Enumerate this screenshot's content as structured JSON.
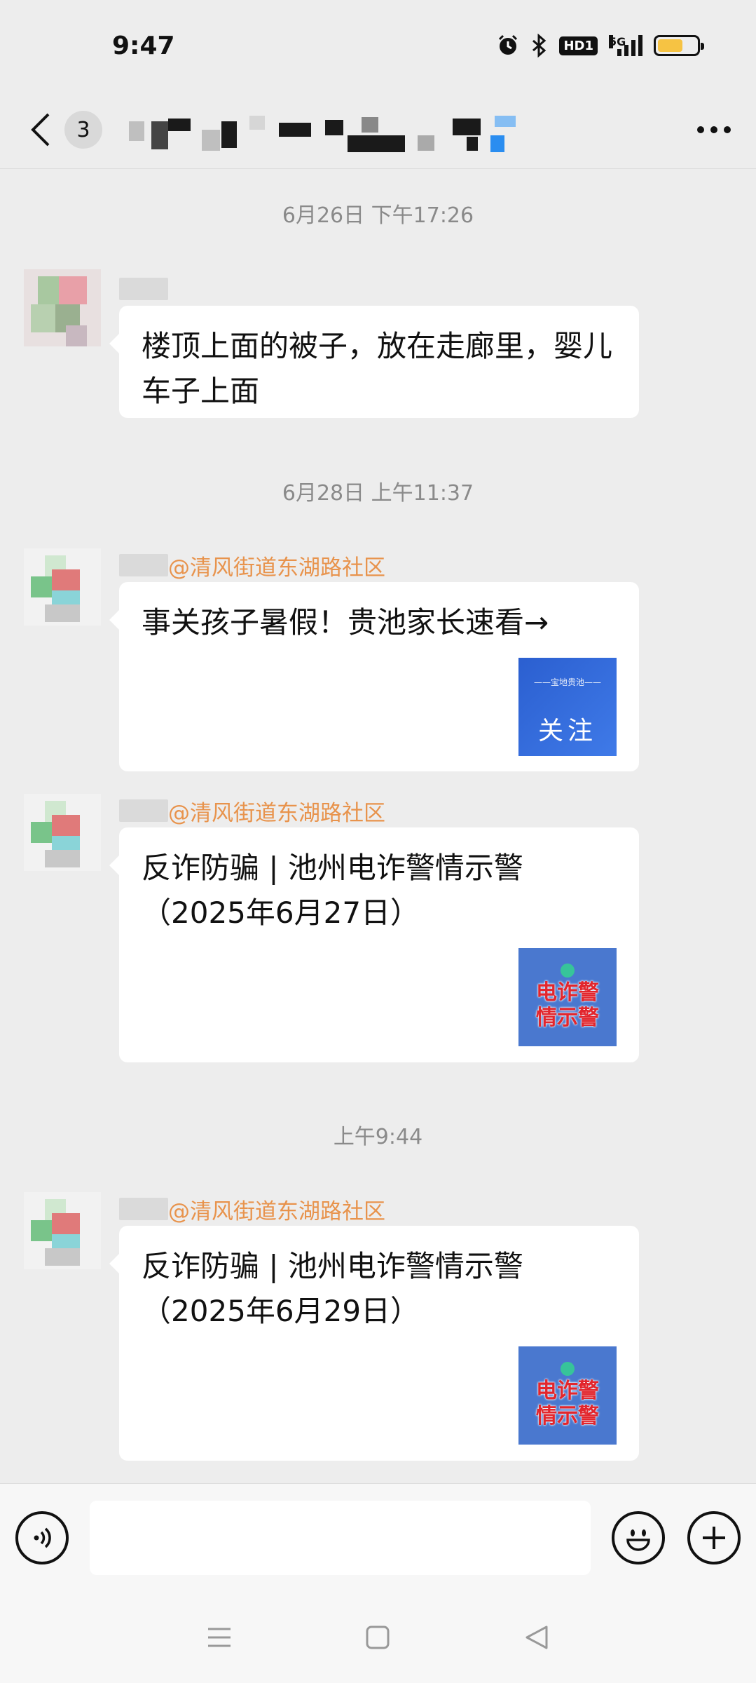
{
  "status_bar": {
    "time": "9:47",
    "hd_label": "HD1",
    "network_label": "5G",
    "battery_level": 0.65,
    "icons": [
      "alarm-icon",
      "bluetooth-icon",
      "hd-icon",
      "signal-icon",
      "battery-icon"
    ]
  },
  "header": {
    "unread_count": "3",
    "icons": [
      "back-icon",
      "more-icon"
    ]
  },
  "chat": {
    "separators": [
      "6月26日 下午17:26",
      "6月28日 上午11:37",
      "上午9:44"
    ],
    "messages": [
      {
        "sender_tag": "",
        "text": "楼顶上面的被子，放在走廊里，婴儿车子上面"
      },
      {
        "sender_tag": "@清风街道东湖路社区",
        "text": "事关孩子暑假！贵池家长速看→",
        "thumb_top": "——宝地贵池——",
        "thumb_main": "关注"
      },
      {
        "sender_tag": "@清风街道东湖路社区",
        "text": "反诈防骗 | 池州电诈警情示警（2025年6月27日）",
        "thumb_main": "电诈警情示警"
      },
      {
        "sender_tag": "@清风街道东湖路社区",
        "text": "反诈防骗 | 池州电诈警情示警（2025年6月29日）",
        "thumb_main": "电诈警情示警"
      }
    ]
  },
  "input_bar": {
    "placeholder": "",
    "icons": [
      "voice-icon",
      "emoji-icon",
      "plus-icon"
    ]
  },
  "nav_bar": {
    "icons": [
      "menu-icon",
      "home-icon",
      "back-triangle-icon"
    ]
  }
}
